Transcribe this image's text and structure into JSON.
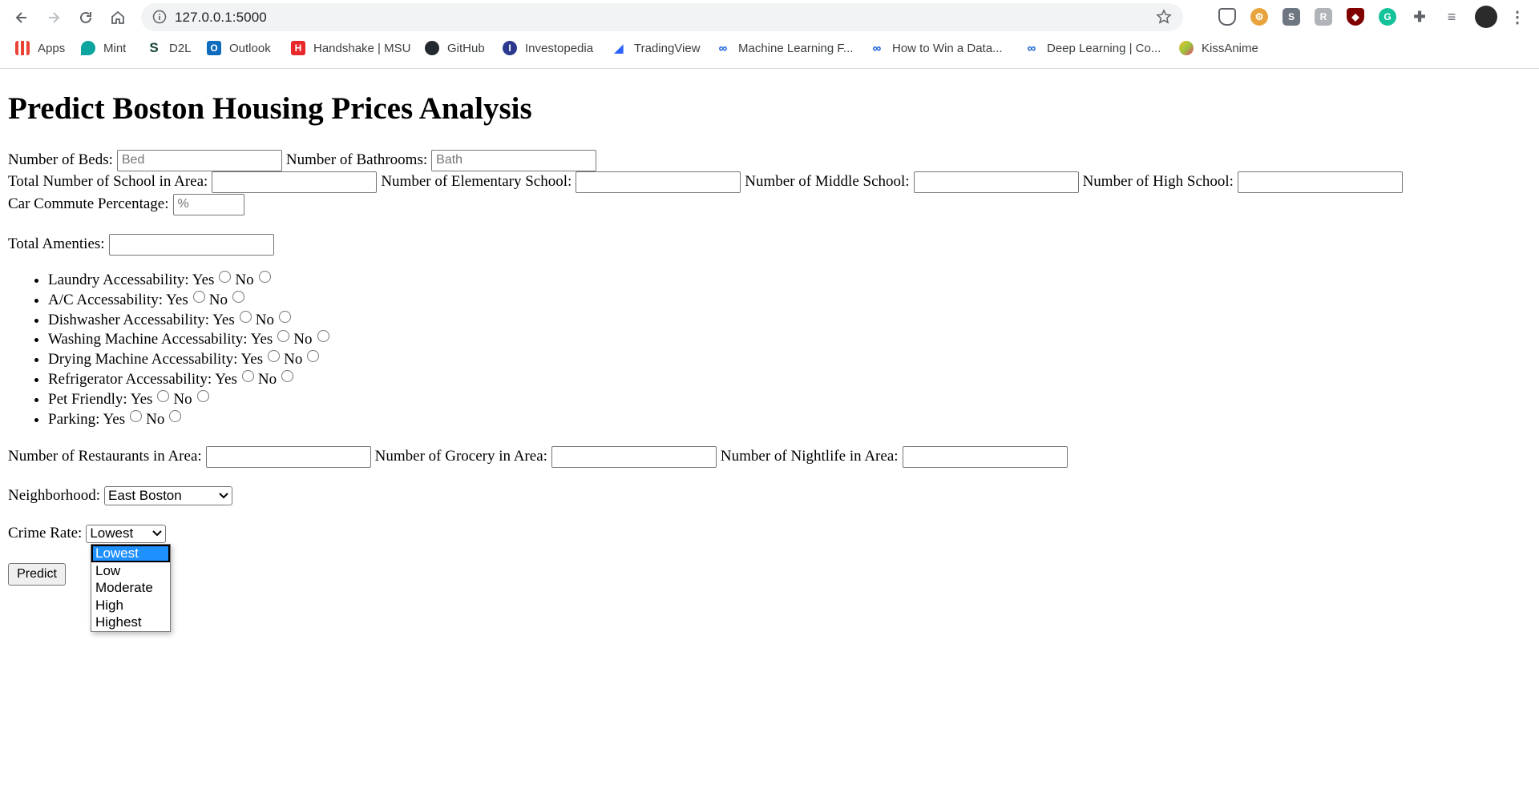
{
  "browser": {
    "url": "127.0.0.1:5000",
    "bookmarks": [
      {
        "label": "Apps",
        "icon": "apps-grid-icon"
      },
      {
        "label": "Mint",
        "icon": "mint-icon"
      },
      {
        "label": "D2L",
        "icon": "d2l-icon"
      },
      {
        "label": "Outlook",
        "icon": "outlook-icon"
      },
      {
        "label": "Handshake | MSU",
        "icon": "handshake-icon"
      },
      {
        "label": "GitHub",
        "icon": "github-icon"
      },
      {
        "label": "Investopedia",
        "icon": "investopedia-icon"
      },
      {
        "label": "TradingView",
        "icon": "tradingview-icon"
      },
      {
        "label": "Machine Learning F...",
        "icon": "coursera-icon"
      },
      {
        "label": "How to Win a Data...",
        "icon": "coursera-icon"
      },
      {
        "label": "Deep Learning | Co...",
        "icon": "coursera-icon"
      },
      {
        "label": "KissAnime",
        "icon": "kissanime-icon"
      }
    ]
  },
  "page": {
    "title": "Predict Boston Housing Prices Analysis",
    "fields": {
      "beds_label": "Number of Beds:",
      "beds_placeholder": "Bed",
      "baths_label": "Number of Bathrooms:",
      "baths_placeholder": "Bath",
      "schools_label": "Total Number of School in Area:",
      "elementary_label": "Number of Elementary School:",
      "middle_label": "Number of Middle School:",
      "high_label": "Number of High School:",
      "commute_label": "Car Commute Percentage:",
      "commute_placeholder": "%",
      "amenities_label": "Total Amenties:",
      "restaurants_label": "Number of Restaurants in Area:",
      "grocery_label": "Number of Grocery in Area:",
      "nightlife_label": "Number of Nightlife in Area:",
      "neighborhood_label": "Neighborhood:",
      "neighborhood_value": "East Boston",
      "crime_label": "Crime Rate:",
      "crime_value": "Lowest"
    },
    "amenities": [
      {
        "label": "Laundry Accessability:"
      },
      {
        "label": "A/C Accessability:"
      },
      {
        "label": "Dishwasher Accessability:"
      },
      {
        "label": "Washing Machine Accessability:"
      },
      {
        "label": "Drying Machine Accessability:"
      },
      {
        "label": "Refrigerator Accessability:"
      },
      {
        "label": "Pet Friendly:"
      },
      {
        "label": "Parking:"
      }
    ],
    "yes_label": "Yes",
    "no_label": "No",
    "crime_options": [
      "Lowest",
      "Low",
      "Moderate",
      "High",
      "Highest"
    ],
    "crime_selected_option": "Lowest",
    "predict_label": "Predict"
  },
  "colors": {
    "highlight": "#1e90ff",
    "omnibox_bg": "#f1f3f4"
  }
}
